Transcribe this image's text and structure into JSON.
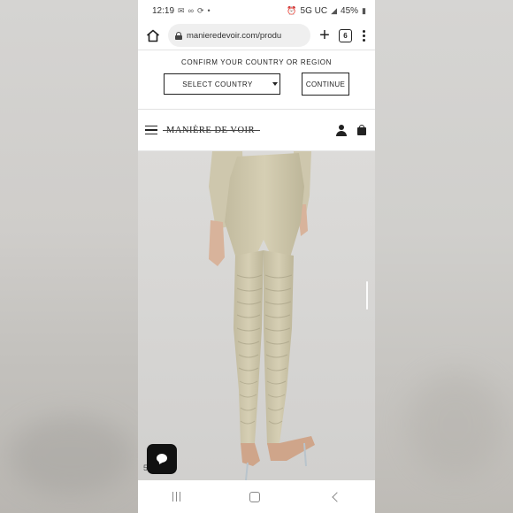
{
  "status_bar": {
    "time": "12:19",
    "network": "5G UC",
    "battery": "45%"
  },
  "browser": {
    "url": "manieredevoir.com/produ",
    "tab_count": "6"
  },
  "country_banner": {
    "title": "CONFIRM YOUR COUNTRY OR REGION",
    "select_label": "SELECT COUNTRY",
    "continue_label": "CONTINUE"
  },
  "site_header": {
    "logo": "MANIÈRE DE VOIR"
  },
  "product": {
    "image_icon": "product-photo",
    "count_hint": "5"
  },
  "colors": {
    "accent": "#222222",
    "pants": "#cfc8ae",
    "background": "#d6d5d3"
  }
}
